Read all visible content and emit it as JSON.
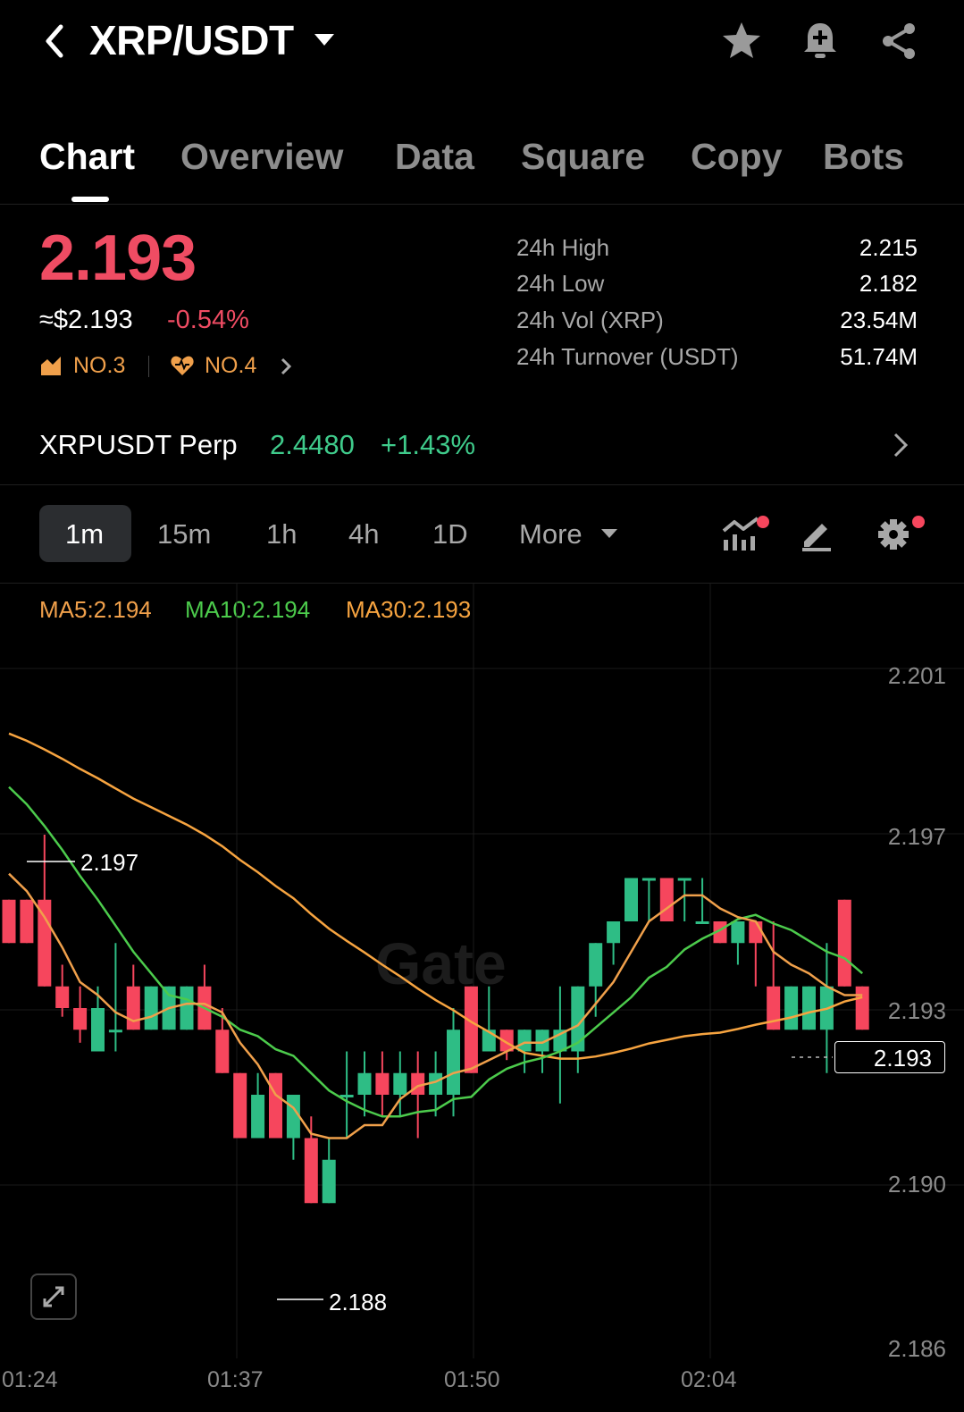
{
  "header": {
    "pair": "XRP/USDT",
    "icons": [
      "back-icon",
      "star-icon",
      "bell-plus-icon",
      "share-icon"
    ]
  },
  "tabs": [
    "Chart",
    "Overview",
    "Data",
    "Square",
    "Copy",
    "Bots"
  ],
  "ticker": {
    "last_price": "2.193",
    "usd_value": "≈$2.193",
    "change": "-0.54%",
    "rank1": "NO.3",
    "rank2": "NO.4",
    "stats": [
      {
        "label": "24h High",
        "value": "2.215"
      },
      {
        "label": "24h Low",
        "value": "2.182"
      },
      {
        "label": "24h Vol (XRP)",
        "value": "23.54M"
      },
      {
        "label": "24h Turnover (USDT)",
        "value": "51.74M"
      }
    ]
  },
  "perp": {
    "name": "XRPUSDT Perp",
    "price": "2.4480",
    "change": "+1.43%"
  },
  "intervals": [
    "1m",
    "15m",
    "1h",
    "4h",
    "1D",
    "More"
  ],
  "ma": {
    "ma5": "MA5:2.194",
    "ma10": "MA10:2.194",
    "ma30": "MA30:2.193"
  },
  "colors": {
    "up": "#2ebd85",
    "down": "#f6465d",
    "ma5": "#f0a04b",
    "ma10": "#4ccb4c",
    "ma30": "#f7a440"
  },
  "chart_data": {
    "type": "candlestick",
    "y_ticks": [
      "2.201",
      "2.197",
      "2.193",
      "2.190",
      "2.186"
    ],
    "x_ticks": [
      "01:24",
      "01:37",
      "01:50",
      "02:04"
    ],
    "current_price": "2.193",
    "annotations": {
      "high": "2.197",
      "low": "2.188"
    },
    "watermark": "Gate",
    "candles": [
      [
        "d",
        2.1955,
        2.1945,
        2.1955,
        2.1945
      ],
      [
        "d",
        2.1955,
        2.1945,
        2.1955,
        2.1945
      ],
      [
        "d",
        2.1955,
        2.1935,
        2.197,
        2.1935
      ],
      [
        "d",
        2.1935,
        2.193,
        2.194,
        2.1928
      ],
      [
        "d",
        2.193,
        2.1925,
        2.1935,
        2.1922
      ],
      [
        "u",
        2.192,
        2.193,
        2.1935,
        2.192
      ],
      [
        "u",
        2.1925,
        2.1925,
        2.1945,
        2.192
      ],
      [
        "d",
        2.1935,
        2.1925,
        2.194,
        2.1925
      ],
      [
        "u",
        2.1925,
        2.1935,
        2.1935,
        2.1925
      ],
      [
        "u",
        2.1925,
        2.1935,
        2.1935,
        2.1925
      ],
      [
        "u",
        2.1925,
        2.1935,
        2.1935,
        2.1925
      ],
      [
        "d",
        2.1935,
        2.1925,
        2.194,
        2.1925
      ],
      [
        "d",
        2.1925,
        2.1915,
        2.193,
        2.1915
      ],
      [
        "d",
        2.1915,
        2.19,
        2.1915,
        2.19
      ],
      [
        "u",
        2.19,
        2.191,
        2.1915,
        2.19
      ],
      [
        "d",
        2.1915,
        2.19,
        2.1915,
        2.19
      ],
      [
        "u",
        2.19,
        2.191,
        2.191,
        2.1895
      ],
      [
        "d",
        2.19,
        2.1885,
        2.1905,
        2.1885
      ],
      [
        "u",
        2.1885,
        2.1895,
        2.19,
        2.1885
      ],
      [
        "u",
        2.191,
        2.191,
        2.192,
        2.19
      ],
      [
        "u",
        2.191,
        2.1915,
        2.192,
        2.1905
      ],
      [
        "d",
        2.1915,
        2.191,
        2.192,
        2.1905
      ],
      [
        "u",
        2.191,
        2.1915,
        2.192,
        2.1905
      ],
      [
        "d",
        2.1915,
        2.191,
        2.192,
        2.19
      ],
      [
        "u",
        2.191,
        2.1915,
        2.192,
        2.1905
      ],
      [
        "u",
        2.191,
        2.1925,
        2.193,
        2.1905
      ],
      [
        "d",
        2.1935,
        2.1915,
        2.1935,
        2.1915
      ],
      [
        "u",
        2.192,
        2.1925,
        2.1935,
        2.192
      ],
      [
        "d",
        2.1925,
        2.192,
        2.1925,
        2.1918
      ],
      [
        "u",
        2.192,
        2.1925,
        2.1925,
        2.1915
      ],
      [
        "u",
        2.192,
        2.1925,
        2.1925,
        2.1915
      ],
      [
        "u",
        2.192,
        2.1925,
        2.1935,
        2.1908
      ],
      [
        "u",
        2.192,
        2.1935,
        2.1935,
        2.1915
      ],
      [
        "u",
        2.1935,
        2.1945,
        2.1945,
        2.1928
      ],
      [
        "u",
        2.1945,
        2.195,
        2.195,
        2.194
      ],
      [
        "u",
        2.195,
        2.196,
        2.196,
        2.195
      ],
      [
        "u",
        2.196,
        2.196,
        2.196,
        2.195
      ],
      [
        "d",
        2.196,
        2.195,
        2.196,
        2.195
      ],
      [
        "u",
        2.196,
        2.196,
        2.196,
        2.195
      ],
      [
        "u",
        2.195,
        2.195,
        2.196,
        2.195
      ],
      [
        "d",
        2.195,
        2.1945,
        2.195,
        2.1945
      ],
      [
        "u",
        2.1945,
        2.195,
        2.195,
        2.194
      ],
      [
        "d",
        2.195,
        2.1945,
        2.195,
        2.1935
      ],
      [
        "d",
        2.1935,
        2.1925,
        2.195,
        2.1925
      ],
      [
        "u",
        2.1925,
        2.1935,
        2.1935,
        2.1925
      ],
      [
        "u",
        2.1925,
        2.1935,
        2.1935,
        2.1925
      ],
      [
        "u",
        2.1925,
        2.1935,
        2.1945,
        2.1915
      ],
      [
        "d",
        2.1955,
        2.1935,
        2.1955,
        2.1935
      ],
      [
        "d",
        2.1935,
        2.1925,
        2.1935,
        2.1925
      ]
    ]
  }
}
